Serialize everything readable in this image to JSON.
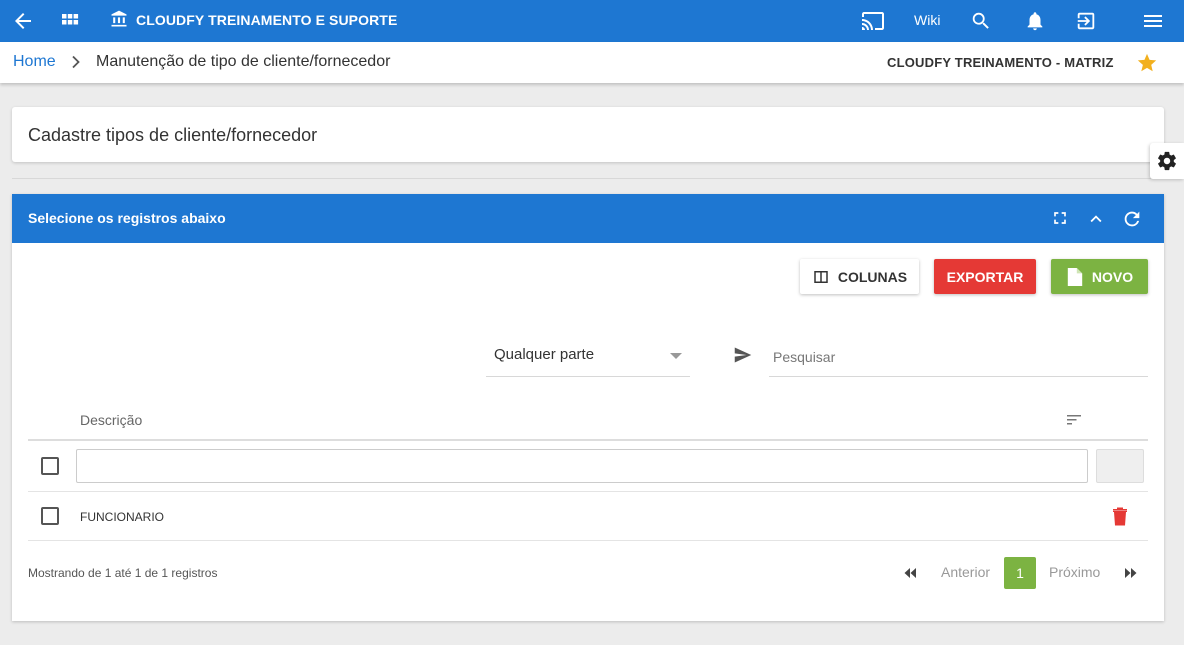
{
  "header": {
    "app_title": "CLOUDFY TREINAMENTO E SUPORTE",
    "wiki_label": "Wiki",
    "icons": [
      "back-arrow-icon",
      "apps-grid-icon",
      "bank-icon",
      "cast-icon",
      "search-icon",
      "bell-icon",
      "exit-icon",
      "menu-icon"
    ]
  },
  "breadcrumb": {
    "home": "Home",
    "current": "Manutenção de tipo de cliente/fornecedor",
    "company": "CLOUDFY TREINAMENTO - MATRIZ"
  },
  "page": {
    "title": "Cadastre tipos de cliente/fornecedor"
  },
  "panel": {
    "title": "Selecione os registros abaixo",
    "buttons": {
      "columns": "COLUNAS",
      "export": "EXPORTAR",
      "new": "NOVO"
    },
    "filter": {
      "mode_value": "Qualquer parte",
      "search_placeholder": "Pesquisar"
    },
    "table": {
      "columns": [
        "Descrição"
      ],
      "rows": [
        {
          "descricao": "FUNCIONARIO"
        }
      ]
    },
    "footer": {
      "showing": "Mostrando de 1 até 1 de 1 registros",
      "prev": "Anterior",
      "current_page": "1",
      "next": "Próximo"
    }
  },
  "colors": {
    "primary": "#1e77d2",
    "export": "#e53935",
    "new": "#7cb342",
    "star": "#f2b01e",
    "delete": "#e53935"
  }
}
